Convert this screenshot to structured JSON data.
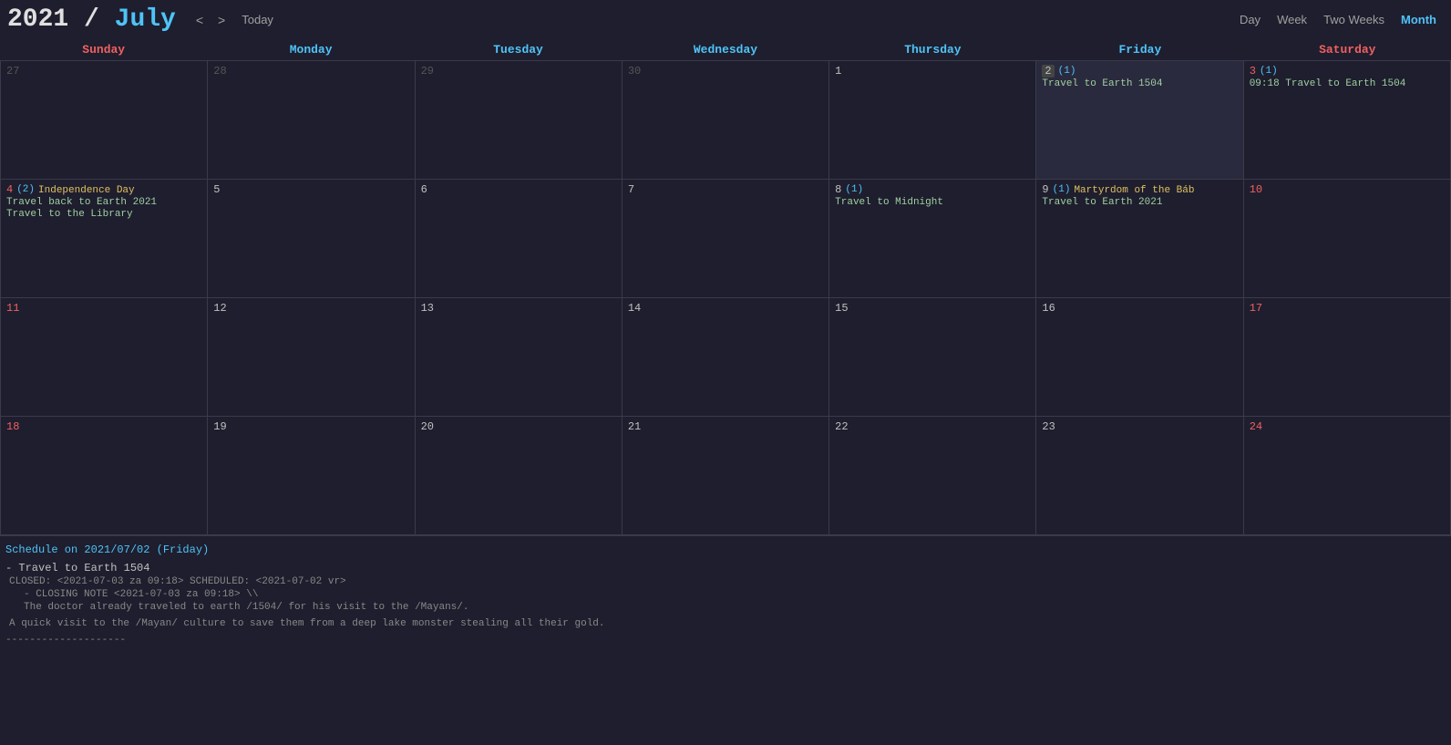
{
  "header": {
    "year": "2021",
    "slash": " / ",
    "month": "July",
    "prev_label": "<",
    "next_label": ">",
    "today_label": "Today",
    "views": [
      "Day",
      "Week",
      "Two Weeks",
      "Month"
    ],
    "active_view": "Month"
  },
  "day_headers": [
    {
      "label": "Sunday",
      "type": "sunday"
    },
    {
      "label": "Monday",
      "type": "weekday"
    },
    {
      "label": "Tuesday",
      "type": "weekday"
    },
    {
      "label": "Wednesday",
      "type": "weekday"
    },
    {
      "label": "Thursday",
      "type": "weekday"
    },
    {
      "label": "Friday",
      "type": "weekday"
    },
    {
      "label": "Saturday",
      "type": "saturday"
    }
  ],
  "weeks": [
    [
      {
        "day": "27",
        "other": true,
        "type": "sunday"
      },
      {
        "day": "28",
        "other": true,
        "type": "weekday"
      },
      {
        "day": "29",
        "other": true,
        "type": "weekday"
      },
      {
        "day": "30",
        "other": true,
        "type": "weekday"
      },
      {
        "day": "1",
        "other": false,
        "type": "weekday",
        "events": []
      },
      {
        "day": "2",
        "other": false,
        "type": "weekday",
        "highlighted": true,
        "count": "(1)",
        "events": [
          {
            "label": "Travel to Earth 1504",
            "color": "green"
          }
        ]
      },
      {
        "day": "3",
        "other": false,
        "type": "saturday",
        "count": "(1)",
        "events": [
          {
            "label": "09:18 Travel to Earth 1504",
            "color": "green"
          }
        ]
      }
    ],
    [
      {
        "day": "4",
        "other": false,
        "type": "sunday",
        "count": "(2)",
        "holiday": "Independence Day",
        "events": [
          {
            "label": "Travel back to Earth 2021",
            "color": "green"
          },
          {
            "label": "Travel to the Library",
            "color": "green"
          }
        ]
      },
      {
        "day": "5",
        "other": false,
        "type": "weekday"
      },
      {
        "day": "6",
        "other": false,
        "type": "weekday"
      },
      {
        "day": "7",
        "other": false,
        "type": "weekday"
      },
      {
        "day": "8",
        "other": false,
        "type": "weekday",
        "count": "(1)",
        "events": [
          {
            "label": "Travel to Midnight",
            "color": "green"
          }
        ]
      },
      {
        "day": "9",
        "other": false,
        "type": "weekday",
        "count": "(1)",
        "holiday": "Martyrdom of the Báb",
        "events": [
          {
            "label": "Travel to Earth 2021",
            "color": "green"
          }
        ]
      },
      {
        "day": "10",
        "other": false,
        "type": "saturday"
      }
    ],
    [
      {
        "day": "11",
        "other": false,
        "type": "sunday"
      },
      {
        "day": "12",
        "other": false,
        "type": "weekday"
      },
      {
        "day": "13",
        "other": false,
        "type": "weekday"
      },
      {
        "day": "14",
        "other": false,
        "type": "weekday"
      },
      {
        "day": "15",
        "other": false,
        "type": "weekday"
      },
      {
        "day": "16",
        "other": false,
        "type": "weekday"
      },
      {
        "day": "17",
        "other": false,
        "type": "saturday"
      }
    ],
    [
      {
        "day": "18",
        "other": false,
        "type": "sunday"
      },
      {
        "day": "19",
        "other": false,
        "type": "weekday"
      },
      {
        "day": "20",
        "other": false,
        "type": "weekday"
      },
      {
        "day": "21",
        "other": false,
        "type": "weekday"
      },
      {
        "day": "22",
        "other": false,
        "type": "weekday"
      },
      {
        "day": "23",
        "other": false,
        "type": "weekday"
      },
      {
        "day": "24",
        "other": false,
        "type": "saturday"
      }
    ]
  ],
  "schedule": {
    "title": "Schedule on 2021/07/02 (Friday)",
    "entries": [
      {
        "title": "- Travel to Earth 1504",
        "meta": "CLOSED: <2021-07-03 za 09:18> SCHEDULED: <2021-07-02 vr>",
        "note_label": "- CLOSING NOTE <2021-07-03 za 09:18> \\\\",
        "note_body": "   The doctor already traveled to earth /1504/ for his visit to the /Mayans/.",
        "desc": "  A quick visit to the /Mayan/ culture to save them from a deep lake monster stealing all their gold."
      }
    ],
    "separator": "--------------------"
  }
}
